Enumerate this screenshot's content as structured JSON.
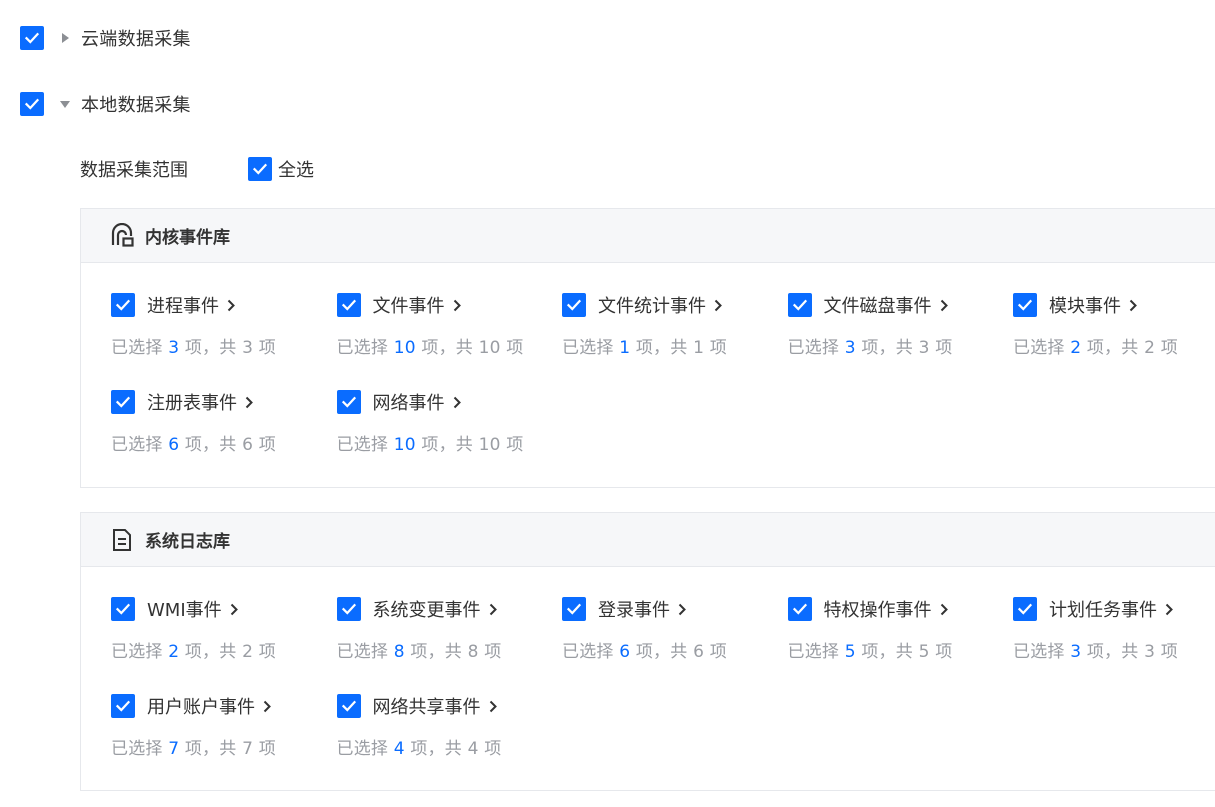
{
  "cloud": {
    "label": "云端数据采集",
    "checked": true,
    "expanded": false
  },
  "local": {
    "label": "本地数据采集",
    "checked": true,
    "expanded": true
  },
  "scope": {
    "label": "数据采集范围",
    "select_all_label": "全选",
    "select_all_checked": true
  },
  "kernel": {
    "title": "内核事件库",
    "icon": "kernel-library-icon",
    "items": [
      {
        "label": "进程事件",
        "selected": "3",
        "total": "3"
      },
      {
        "label": "文件事件",
        "selected": "10",
        "total": "10"
      },
      {
        "label": "文件统计事件",
        "selected": "1",
        "total": "1"
      },
      {
        "label": "文件磁盘事件",
        "selected": "3",
        "total": "3"
      },
      {
        "label": "模块事件",
        "selected": "2",
        "total": "2"
      },
      {
        "label": "注册表事件",
        "selected": "6",
        "total": "6"
      },
      {
        "label": "网络事件",
        "selected": "10",
        "total": "10"
      }
    ]
  },
  "syslog": {
    "title": "系统日志库",
    "icon": "document-icon",
    "items": [
      {
        "label": "WMI事件",
        "selected": "2",
        "total": "2"
      },
      {
        "label": "系统变更事件",
        "selected": "8",
        "total": "8"
      },
      {
        "label": "登录事件",
        "selected": "6",
        "total": "6"
      },
      {
        "label": "特权操作事件",
        "selected": "5",
        "total": "5"
      },
      {
        "label": "计划任务事件",
        "selected": "3",
        "total": "3"
      },
      {
        "label": "用户账户事件",
        "selected": "7",
        "total": "7"
      },
      {
        "label": "网络共享事件",
        "selected": "4",
        "total": "4"
      }
    ]
  },
  "summary_text": {
    "prefix": "已选择",
    "middle": "项，共",
    "suffix": "项"
  },
  "colors": {
    "accent": "#0a6cff",
    "muted": "#9a9da3",
    "text": "#333333",
    "panel_header_bg": "#f6f7f9"
  }
}
